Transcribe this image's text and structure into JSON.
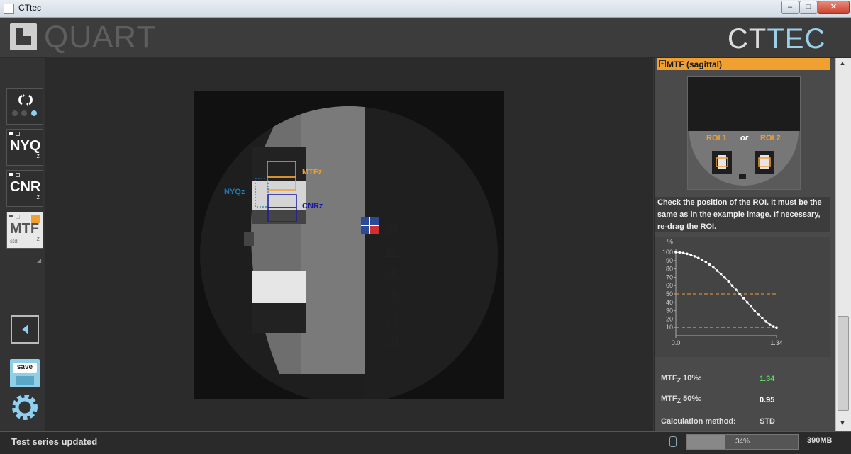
{
  "window": {
    "title": "CTtec",
    "min_icon": "minimize-icon",
    "max_icon": "maximize-icon",
    "close_icon": "close-icon"
  },
  "header": {
    "brand": "QUART",
    "vendor_ct": "CT",
    "vendor_tec": "TEC"
  },
  "toolbar": {
    "tools": [
      {
        "id": "cycle",
        "icon": "cycle-icon"
      },
      {
        "id": "nyq",
        "label": "NYQ",
        "sub": "z"
      },
      {
        "id": "cnr",
        "label": "CNR",
        "sub": "z"
      },
      {
        "id": "mtf",
        "label": "MTF",
        "sub": "z",
        "mode": "std"
      }
    ],
    "back_icon": "back-arrow-icon",
    "save_label": "save",
    "settings_icon": "gear-icon"
  },
  "viewer": {
    "roi_labels": {
      "mtf": "MTFz",
      "nyq": "NYQz",
      "cnr": "CNRz"
    },
    "watermark": "展业达鸿公司",
    "colors": {
      "mtf": "#f0a030",
      "nyq": "#1e7ab0",
      "cnr": "#1a1aa0"
    }
  },
  "panel": {
    "section_title": "MTF (sagittal)",
    "example": {
      "roi1": "ROI 1",
      "or": "or",
      "roi2": "ROI 2"
    },
    "note": "Check the position of the ROI. It must be the same as in the example image. If necessary, re-drag the ROI.",
    "results": [
      {
        "label": "MTF",
        "sub": "Z",
        "suffix": " 10%:",
        "value": "1.34",
        "color": "#5ed85e"
      },
      {
        "label": "MTF",
        "sub": "Z",
        "suffix": " 50%:",
        "value": "0.95",
        "color": "#ffffff"
      },
      {
        "label": "Calculation method:",
        "sub": "",
        "suffix": "",
        "value": "STD",
        "color": "#dddddd"
      }
    ]
  },
  "chart_data": {
    "type": "line",
    "ylabel": "%",
    "ylim": [
      0,
      100
    ],
    "yticks": [
      10,
      20,
      30,
      40,
      50,
      60,
      70,
      80,
      90,
      100
    ],
    "xlim": [
      0,
      1.34
    ],
    "xticks": [
      "0.0",
      "1.34"
    ],
    "grid": false,
    "reference_lines": [
      50,
      10
    ],
    "series": [
      {
        "x": [
          0.0,
          0.05,
          0.1,
          0.15,
          0.2,
          0.25,
          0.3,
          0.35,
          0.4,
          0.45,
          0.5,
          0.55,
          0.6,
          0.65,
          0.7,
          0.75,
          0.8,
          0.85,
          0.9,
          0.95,
          1.0,
          1.05,
          1.1,
          1.15,
          1.2,
          1.25,
          1.3,
          1.34
        ],
        "y": [
          100,
          99.6,
          99,
          98,
          96.7,
          95,
          93,
          90.7,
          88,
          85,
          81.7,
          78,
          74,
          69.7,
          65,
          60,
          55,
          50,
          45,
          40,
          35,
          30,
          25.5,
          21,
          17,
          13.5,
          11,
          10
        ]
      }
    ]
  },
  "status": {
    "message": "Test series updated",
    "progress_text": "34%",
    "progress": 0.34,
    "memory": "390MB"
  }
}
